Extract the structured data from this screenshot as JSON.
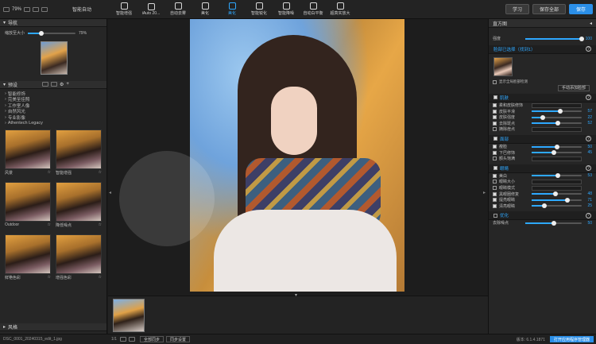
{
  "toolbar": {
    "zoom": "79%",
    "auto_label": "智能自动",
    "tools": [
      {
        "label": "智能增强",
        "icon": "brush-icon"
      },
      {
        "label": "iAuto 20...",
        "icon": "auto-icon"
      },
      {
        "label": "自动去雾",
        "icon": "dehaze-icon"
      },
      {
        "label": "美化",
        "icon": "beauty-icon"
      },
      {
        "label": "美化",
        "icon": "face-icon",
        "active": true
      },
      {
        "label": "智能锐化",
        "icon": "sharpen-icon"
      },
      {
        "label": "智能降噪",
        "icon": "denoise-icon"
      },
      {
        "label": "自动白平衡",
        "icon": "thermometer-icon"
      },
      {
        "label": "超真实放大",
        "icon": "hd-icon"
      }
    ],
    "learn": "学习",
    "save_all": "保存全部",
    "save": "保存"
  },
  "left": {
    "nav_title": "导航",
    "nav_label": "缩放至大小",
    "nav_pct": "79%",
    "presets_title": "预设",
    "tree": [
      "智能修饰",
      "完美至佳照",
      "工作室人像",
      "自然风光",
      "专业影像",
      "Athentech Legacy"
    ],
    "presets": [
      {
        "name": "风景"
      },
      {
        "name": "智能增强"
      },
      {
        "name": "Outdoor"
      },
      {
        "name": "降低噪点"
      },
      {
        "name": "鲜艳色彩"
      },
      {
        "name": "增强色彩"
      }
    ],
    "style_title": "风格"
  },
  "film": {
    "count": "1/1"
  },
  "bottom": {
    "filename": "DSC_0001_20240315_edit_1.jpg",
    "full_sync": "全部同步",
    "sync_settings": "同步设置",
    "version": "版本: 6.1.4.1871",
    "open_cache": "打开应用程序管理器"
  },
  "right": {
    "histogram": "直方图",
    "strength": "强度",
    "strength_val": "100",
    "faces_title": "脸部已选择（找到1）",
    "face_opt": "显示全局脸部检测",
    "manual": "手动添加脸部",
    "skin_title": "肌肤",
    "skin_rows": [
      {
        "label": "柔和皮肤修饰",
        "val": "",
        "on": true
      },
      {
        "label": "皮肤平滑",
        "val": "57",
        "on": true
      },
      {
        "label": "皮肤强度",
        "val": "22",
        "on": true
      },
      {
        "label": "去除斑点",
        "val": "52",
        "on": true
      },
      {
        "label": "摘除痘点",
        "val": "",
        "on": false
      }
    ],
    "face_title": "面部",
    "face_rows": [
      {
        "label": "瘦脸",
        "val": "50",
        "on": true
      },
      {
        "label": "下巴修饰",
        "val": "45",
        "on": true
      },
      {
        "label": "额头饱满",
        "val": "",
        "on": false
      }
    ],
    "eye_title": "眼睛",
    "eye_rows": [
      {
        "label": "美白",
        "val": "53",
        "on": true
      },
      {
        "label": "眼睛大小",
        "val": "",
        "on": false
      },
      {
        "label": "眼睛模式",
        "val": "",
        "on": false
      },
      {
        "label": "黑眼圈修复",
        "val": "48",
        "on": true
      },
      {
        "label": "提亮眼睛",
        "val": "71",
        "on": true
      },
      {
        "label": "清亮眼睛",
        "val": "25",
        "on": true
      }
    ],
    "adjust_title": "优化",
    "adjust_row": "去除噪点",
    "adjust_val": "50"
  }
}
